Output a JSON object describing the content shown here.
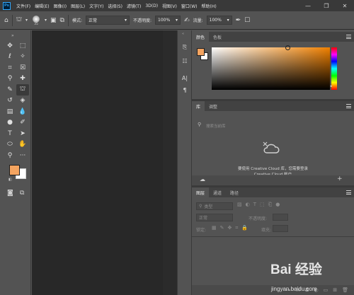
{
  "app": {
    "logo_text": "Ps",
    "menu": [
      "文件(F)",
      "编辑(E)",
      "图像(I)",
      "图层(L)",
      "文字(Y)",
      "选择(S)",
      "滤镜(T)",
      "3D(D)",
      "视图(V)",
      "窗口(W)",
      "帮助(H)"
    ],
    "window_controls": [
      "—",
      "❐",
      "✕"
    ]
  },
  "options_bar": {
    "brush_size": "35",
    "mode_label": "模式:",
    "mode_value": "正常",
    "opacity_label": "不透明度:",
    "opacity_value": "100%",
    "flow_label": "流量:",
    "flow_value": "100%"
  },
  "tools": {
    "foreground_color": "#f4a460",
    "background_color": "#ffffff"
  },
  "color_panel": {
    "tabs": [
      "颜色",
      "色板"
    ],
    "active_tab": 0,
    "hue_color": "#f08000"
  },
  "library_panel": {
    "tabs": [
      "库",
      "调整"
    ],
    "search_placeholder": "搜索当前库",
    "message_line1": "要使用 Creative Cloud 库，您需要登录",
    "message_line2": "Creative Cloud 帐户"
  },
  "layers_panel": {
    "tabs": [
      "图层",
      "通道",
      "路径"
    ],
    "filter_kind": "类型",
    "blend_mode": "正常",
    "opacity_label": "不透明度:",
    "lock_label": "锁定:",
    "fill_label": "填充:"
  },
  "watermark": {
    "brand": "Bai 经验",
    "url": "jingyan.baidu.com"
  }
}
